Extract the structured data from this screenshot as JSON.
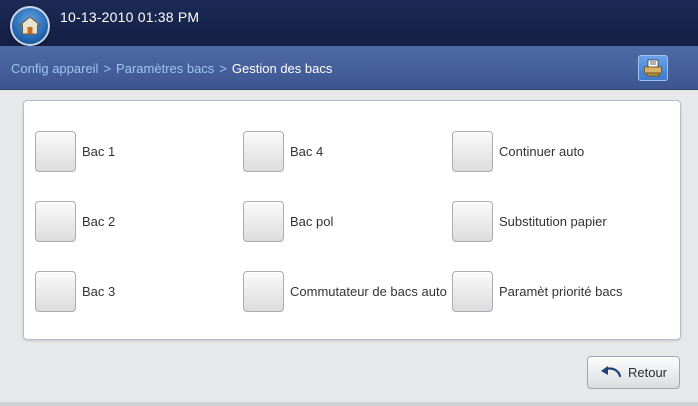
{
  "status_bar": {
    "datetime": "10-13-2010 01:38 PM",
    "home_icon": "home-icon"
  },
  "breadcrumb": {
    "items": [
      "Config appareil",
      "Paramètres bacs"
    ],
    "separator": ">",
    "current": "Gestion des bacs",
    "job_icon": "job-status-icon"
  },
  "options": [
    {
      "label": "Bac 1"
    },
    {
      "label": "Bac 2"
    },
    {
      "label": "Bac 3"
    },
    {
      "label": "Bac 4"
    },
    {
      "label": "Bac pol"
    },
    {
      "label": "Commutateur de bacs auto"
    },
    {
      "label": "Continuer auto"
    },
    {
      "label": "Substitution papier"
    },
    {
      "label": "Paramèt priorité bacs"
    }
  ],
  "footer": {
    "back_label": "Retour",
    "back_icon": "undo-arrow-icon"
  },
  "colors": {
    "top_bar": "#1c2a55",
    "breadcrumb_bar": "#4f6aa6",
    "breadcrumb_link": "#9ec4f0",
    "accent": "#3f79c8"
  }
}
